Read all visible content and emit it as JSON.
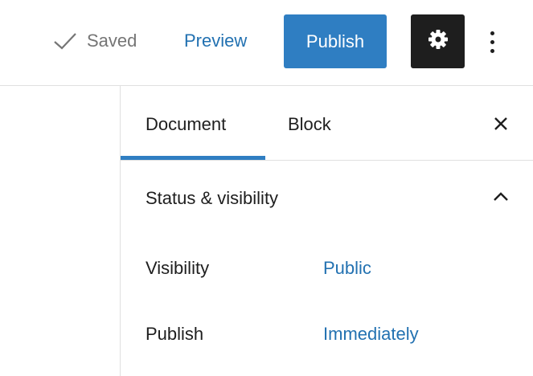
{
  "header": {
    "saved_label": "Saved",
    "preview_label": "Preview",
    "publish_label": "Publish"
  },
  "sidebar": {
    "tabs": [
      {
        "label": "Document",
        "active": true
      },
      {
        "label": "Block",
        "active": false
      }
    ],
    "section": {
      "title": "Status & visibility",
      "expanded": true,
      "rows": [
        {
          "label": "Visibility",
          "value": "Public"
        },
        {
          "label": "Publish",
          "value": "Immediately"
        }
      ]
    }
  },
  "icons": {
    "saved": "check-icon",
    "settings": "gear-icon",
    "more": "more-vertical-icon",
    "close": "close-icon",
    "collapse": "chevron-up-icon"
  },
  "colors": {
    "accent": "#2f7ec2",
    "link": "#2271b1",
    "settings_bg": "#1e1e1e"
  }
}
